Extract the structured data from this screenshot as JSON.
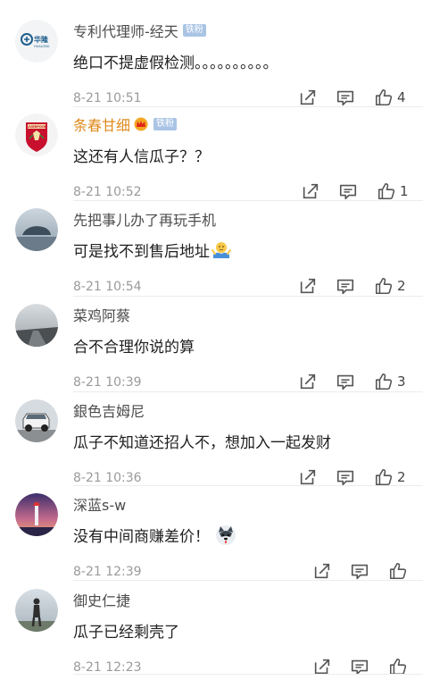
{
  "comments": [
    {
      "name": "专利代理师-经天",
      "badge": "铁粉",
      "text": "绝口不提虚假检测。。。。。。。。。。",
      "time": "8-21 10:51",
      "likes": "4",
      "avatar_text": "华隆",
      "avatar_subtext": "HUALONG"
    },
    {
      "name": "条春甘细",
      "badge": "铁粉",
      "text": "这还有人信瓜子？？",
      "time": "8-21 10:52",
      "likes": "1",
      "avatar_text": "LIVERPOOL"
    },
    {
      "name": "先把事儿办了再玩手机",
      "text": "可是找不到售后地址",
      "time": "8-21 10:54",
      "likes": "2"
    },
    {
      "name": "菜鸡阿蔡",
      "text": "合不合理你说的算",
      "time": "8-21 10:39",
      "likes": "3"
    },
    {
      "name": "銀色吉姆尼",
      "text": "瓜子不知道还招人不，想加入一起发财",
      "time": "8-21 10:36",
      "likes": "2"
    },
    {
      "name": "深蓝s-w",
      "text": "没有中间商赚差价！",
      "time": "8-21 12:39",
      "likes": ""
    },
    {
      "name": "御史仁捷",
      "text": "瓜子已经剩壳了",
      "time": "8-21 12:23",
      "likes": ""
    }
  ],
  "colors": {
    "name": "#4c4c4c",
    "vip_name": "#e08a1e",
    "badge_bg": "#a9c4e4",
    "meta": "#9a9a9a",
    "icon": "#555555"
  },
  "icons": [
    "share-icon",
    "comment-icon",
    "like-icon",
    "crown-icon"
  ]
}
